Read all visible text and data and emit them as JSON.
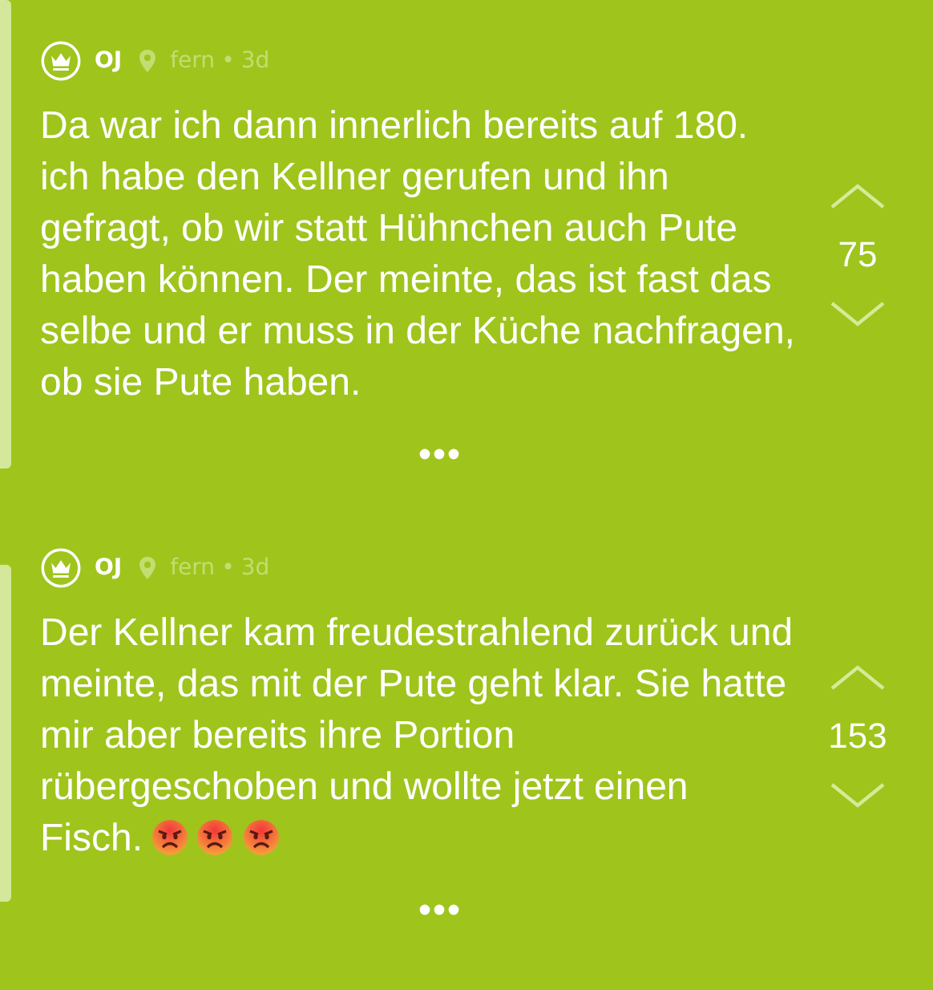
{
  "posts": [
    {
      "author": "OJ",
      "location": "fern",
      "separator": "•",
      "age": "3d",
      "text": "Da war ich dann innerlich bereits auf 180. ich habe den Kellner gerufen und ihn gefragt, ob wir statt Hühnchen auch Pute haben können. Der meinte, das ist fast das selbe und er muss in der Küche nachfragen, ob sie Pute haben.",
      "votes": "75"
    },
    {
      "author": "OJ",
      "location": "fern",
      "separator": "•",
      "age": "3d",
      "text": "Der Kellner kam freudestrahlend zurück und meinte, das mit der Pute geht klar. Sie hatte mir aber bereits ihre Portion rübergeschoben und wollte jetzt einen Fisch.",
      "reactions": [
        {
          "kind": "angry"
        },
        {
          "kind": "angry"
        },
        {
          "kind": "angry"
        }
      ],
      "votes": "153"
    }
  ]
}
